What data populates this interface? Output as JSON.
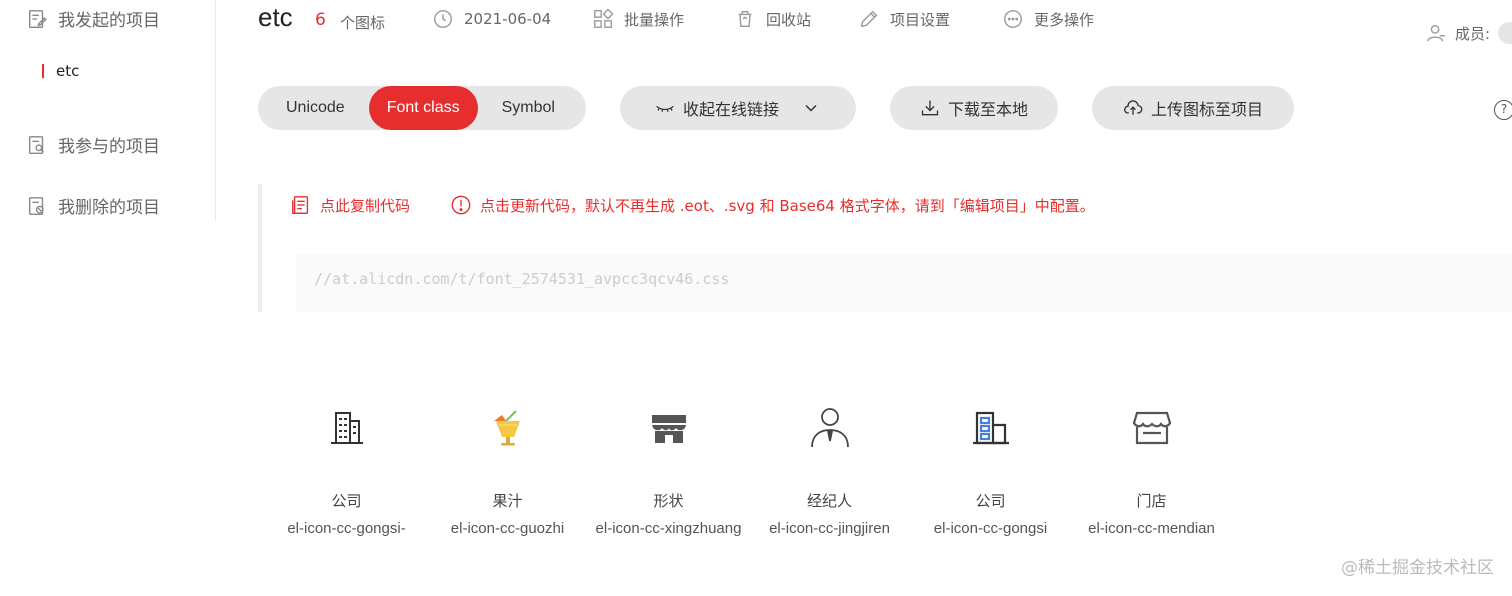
{
  "sidebar": {
    "my_projects": "我发起的项目",
    "current_project": "etc",
    "joined_projects": "我参与的项目",
    "deleted_projects": "我删除的项目"
  },
  "header": {
    "project_name": "etc",
    "icon_count": "6",
    "icon_count_label": "个图标",
    "date": "2021-06-04",
    "batch": "批量操作",
    "recycle": "回收站",
    "settings": "项目设置",
    "more": "更多操作",
    "members": "成员:"
  },
  "toolbar": {
    "tabs": [
      "Unicode",
      "Font class",
      "Symbol"
    ],
    "active_tab": "Font class",
    "collapse_link": "收起在线链接",
    "download": "下载至本地",
    "upload": "上传图标至项目",
    "help": "?"
  },
  "code": {
    "copy": "点此复制代码",
    "update": "点击更新代码，默认不再生成 .eot、.svg 和 Base64 格式字体，请到「编辑项目」中配置。",
    "url": "//at.alicdn.com/t/font_2574531_avpcc3qcv46.css"
  },
  "icons": [
    {
      "cn": "公司",
      "en": "el-icon-cc-gongsi-"
    },
    {
      "cn": "果汁",
      "en": "el-icon-cc-guozhi"
    },
    {
      "cn": "形状",
      "en": "el-icon-cc-xingzhuang"
    },
    {
      "cn": "经纪人",
      "en": "el-icon-cc-jingjiren"
    },
    {
      "cn": "公司",
      "en": "el-icon-cc-gongsi"
    },
    {
      "cn": "门店",
      "en": "el-icon-cc-mendian"
    }
  ],
  "watermark": "@稀土掘金技术社区",
  "colors": {
    "accent": "#e62e2e",
    "pill_bg": "#e6e6e6"
  }
}
